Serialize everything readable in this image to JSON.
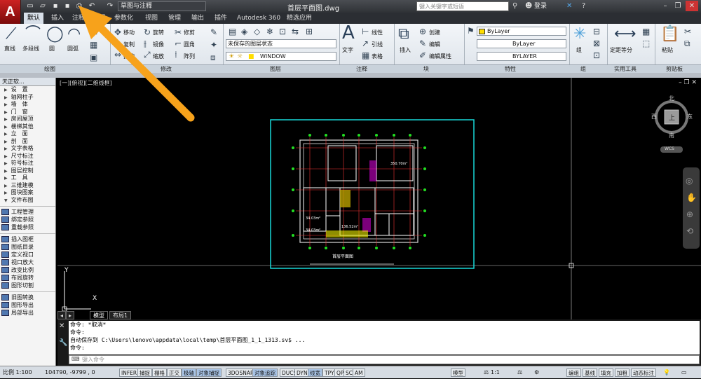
{
  "app": {
    "logo": "A",
    "title": "首层平面图.dwg",
    "workspace": "草图与注释"
  },
  "search": {
    "placeholder": "键入关键字或短语"
  },
  "user": {
    "login": "登录"
  },
  "tabs": [
    "默认",
    "插入",
    "注释",
    "布局",
    "参数化",
    "视图",
    "管理",
    "输出",
    "插件",
    "Autodesk 360",
    "精选应用"
  ],
  "ribbon": {
    "draw_tools": [
      "直线",
      "多段线",
      "圆",
      "圆弧"
    ],
    "modify_tools": [
      "移动",
      "旋转",
      "修剪",
      "复制",
      "镜像",
      "圆角",
      "拉伸",
      "缩放",
      "阵列"
    ],
    "layer": {
      "state": "未保存的图层状态",
      "current": "WINDOW"
    },
    "annotation": {
      "text": "文字",
      "linear": "线性",
      "leader": "引线",
      "table": "表格"
    },
    "block": {
      "insert": "插入",
      "create": "创建",
      "edit": "编辑",
      "edit_attr": "编辑属性"
    },
    "properties": {
      "color": "ByLayer",
      "linetype": "ByLayer",
      "lineweight": "BYLAYER"
    },
    "group": "组",
    "utilities": "定距等分",
    "paste": "粘贴",
    "panels": [
      "绘图",
      "修改",
      "图层",
      "注释",
      "块",
      "特性",
      "组",
      "实用工具",
      "剪贴板"
    ]
  },
  "sidebar": {
    "title": "天正软...",
    "items": [
      "设　置",
      "轴网柱子",
      "墙　体",
      "门　窗",
      "房间屋顶",
      "楼梯其他",
      "立　面",
      "剖　面",
      "文字表格",
      "尺寸标注",
      "符号标注",
      "图层控制",
      "工　具",
      "三维建模",
      "图块图案",
      "文件布图"
    ],
    "tools": [
      "工程管理",
      "绑定参照",
      "重载参照",
      "插入图框",
      "图纸目录",
      "定义视口",
      "视口放大",
      "改变比例",
      "布局旋转",
      "图形切割",
      "旧图转换",
      "图形导出",
      "局部导出"
    ]
  },
  "viewport": {
    "label": "[一][俯视][二维线框]",
    "compass": {
      "north": "北",
      "south": "南",
      "east": "东",
      "west": "西",
      "top": "上"
    },
    "wcs": "WCS",
    "drawing_title": "首层平面图",
    "room_labels": [
      "34.03m²",
      "34.03m²",
      "136.52m²",
      "350.70m²"
    ]
  },
  "layout_tabs": [
    "模型",
    "布局1"
  ],
  "command": {
    "history": [
      "命令: *取消*",
      "命令:",
      "自动保存到 C:\\Users\\lenovo\\appdata\\local\\temp\\首层平面图_1_1_1313.sv$ ...",
      "命令:"
    ],
    "placeholder": "键入命令"
  },
  "status": {
    "scale": "比例 1:100",
    "coords": "104790, -9799 , 0",
    "toggles": [
      "INFER",
      "捕捉",
      "栅格",
      "正交",
      "极轴",
      "对象捕捉",
      "3DOSNAP",
      "对象追踪",
      "DUCS",
      "DYN",
      "线宽",
      "TPY",
      "QP",
      "SC",
      "AM"
    ],
    "right": [
      "模型",
      "1:1",
      "编组",
      "基线",
      "填充",
      "加粗",
      "动态标注"
    ]
  },
  "colors": {
    "accent_arrow": "#f7a21b",
    "canvas": "#000000",
    "frame": "#18d8d8"
  }
}
